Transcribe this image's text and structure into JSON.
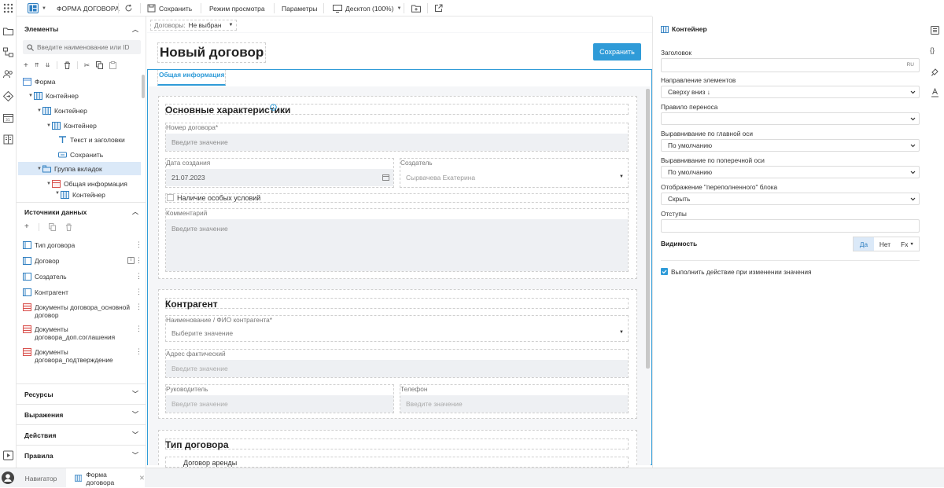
{
  "toolbar": {
    "form_title": "ФОРМА ДОГОВОРА",
    "save": "Сохранить",
    "view_mode": "Режим просмотра",
    "params": "Параметры",
    "desktop": "Десктоп (100%)"
  },
  "left": {
    "elements_title": "Элементы",
    "search_placeholder": "Введите наименование или ID",
    "tree": [
      {
        "label": "Форма"
      },
      {
        "label": "Контейнер"
      },
      {
        "label": "Контейнер"
      },
      {
        "label": "Контейнер"
      },
      {
        "label": "Текст и заголовки"
      },
      {
        "label": "Сохранить"
      },
      {
        "label": "Группа вкладок"
      },
      {
        "label": "Общая информация"
      },
      {
        "label": "Контейнер"
      }
    ],
    "datasources_title": "Источники данных",
    "datasources": [
      {
        "label": "Тип договора"
      },
      {
        "label": "Договор"
      },
      {
        "label": "Создатель"
      },
      {
        "label": "Контрагент"
      },
      {
        "label": "Документы договора_основной договор"
      },
      {
        "label": "Документы договора_доп.соглашения"
      },
      {
        "label": "Документы договора_подтверждение"
      }
    ],
    "resources": "Ресурсы",
    "expressions": "Выражения",
    "actions": "Действия",
    "rules": "Правила"
  },
  "canvas": {
    "contracts_label": "Договоры:",
    "contracts_value": "Не выбран",
    "title": "Новый договор",
    "save_button": "Сохранить",
    "tab": "Общая информация",
    "section1": {
      "title": "Основные характеристики",
      "number_label": "Номер договора*",
      "number_placeholder": "Введите значение",
      "date_label": "Дата создания",
      "date_value": "21.07.2023",
      "creator_label": "Создатель",
      "creator_value": "Сырвачева Екатерина",
      "special_label": "Наличие особых условий",
      "comment_label": "Комментарий",
      "comment_placeholder": "Введите значение"
    },
    "section2": {
      "title": "Контрагент",
      "name_label": "Наименование / ФИО контрагента*",
      "name_placeholder": "Выберите значение",
      "address_label": "Адрес фактический",
      "address_placeholder": "Введите значение",
      "head_label": "Руководитель",
      "head_placeholder": "Введите значение",
      "phone_label": "Телефон",
      "phone_placeholder": "Введите значение"
    },
    "section3": {
      "title": "Тип договора",
      "option": "Договор аренды"
    }
  },
  "right": {
    "header": "Контейнер",
    "heading_label": "Заголовок",
    "lang": "RU",
    "direction_label": "Направление элементов",
    "direction_value": "Сверху вниз ↓",
    "wrap_label": "Правило переноса",
    "main_axis_label": "Выравнивание по главной оси",
    "main_axis_value": "По умолчанию",
    "cross_axis_label": "Выравнивание по поперечной оси",
    "cross_axis_value": "По умолчанию",
    "overflow_label": "Отображение \"переполненного\" блока",
    "overflow_value": "Скрыть",
    "padding_label": "Отступы",
    "visibility_label": "Видимость",
    "vis_yes": "Да",
    "vis_no": "Нет",
    "vis_fx": "Fx",
    "run_action_label": "Выполнить действие при изменении значения"
  },
  "bottom": {
    "navigator": "Навигатор",
    "tab": "Форма договора"
  },
  "colors": {
    "accent": "#2f9bd8",
    "selected": "#dbe9f8"
  }
}
